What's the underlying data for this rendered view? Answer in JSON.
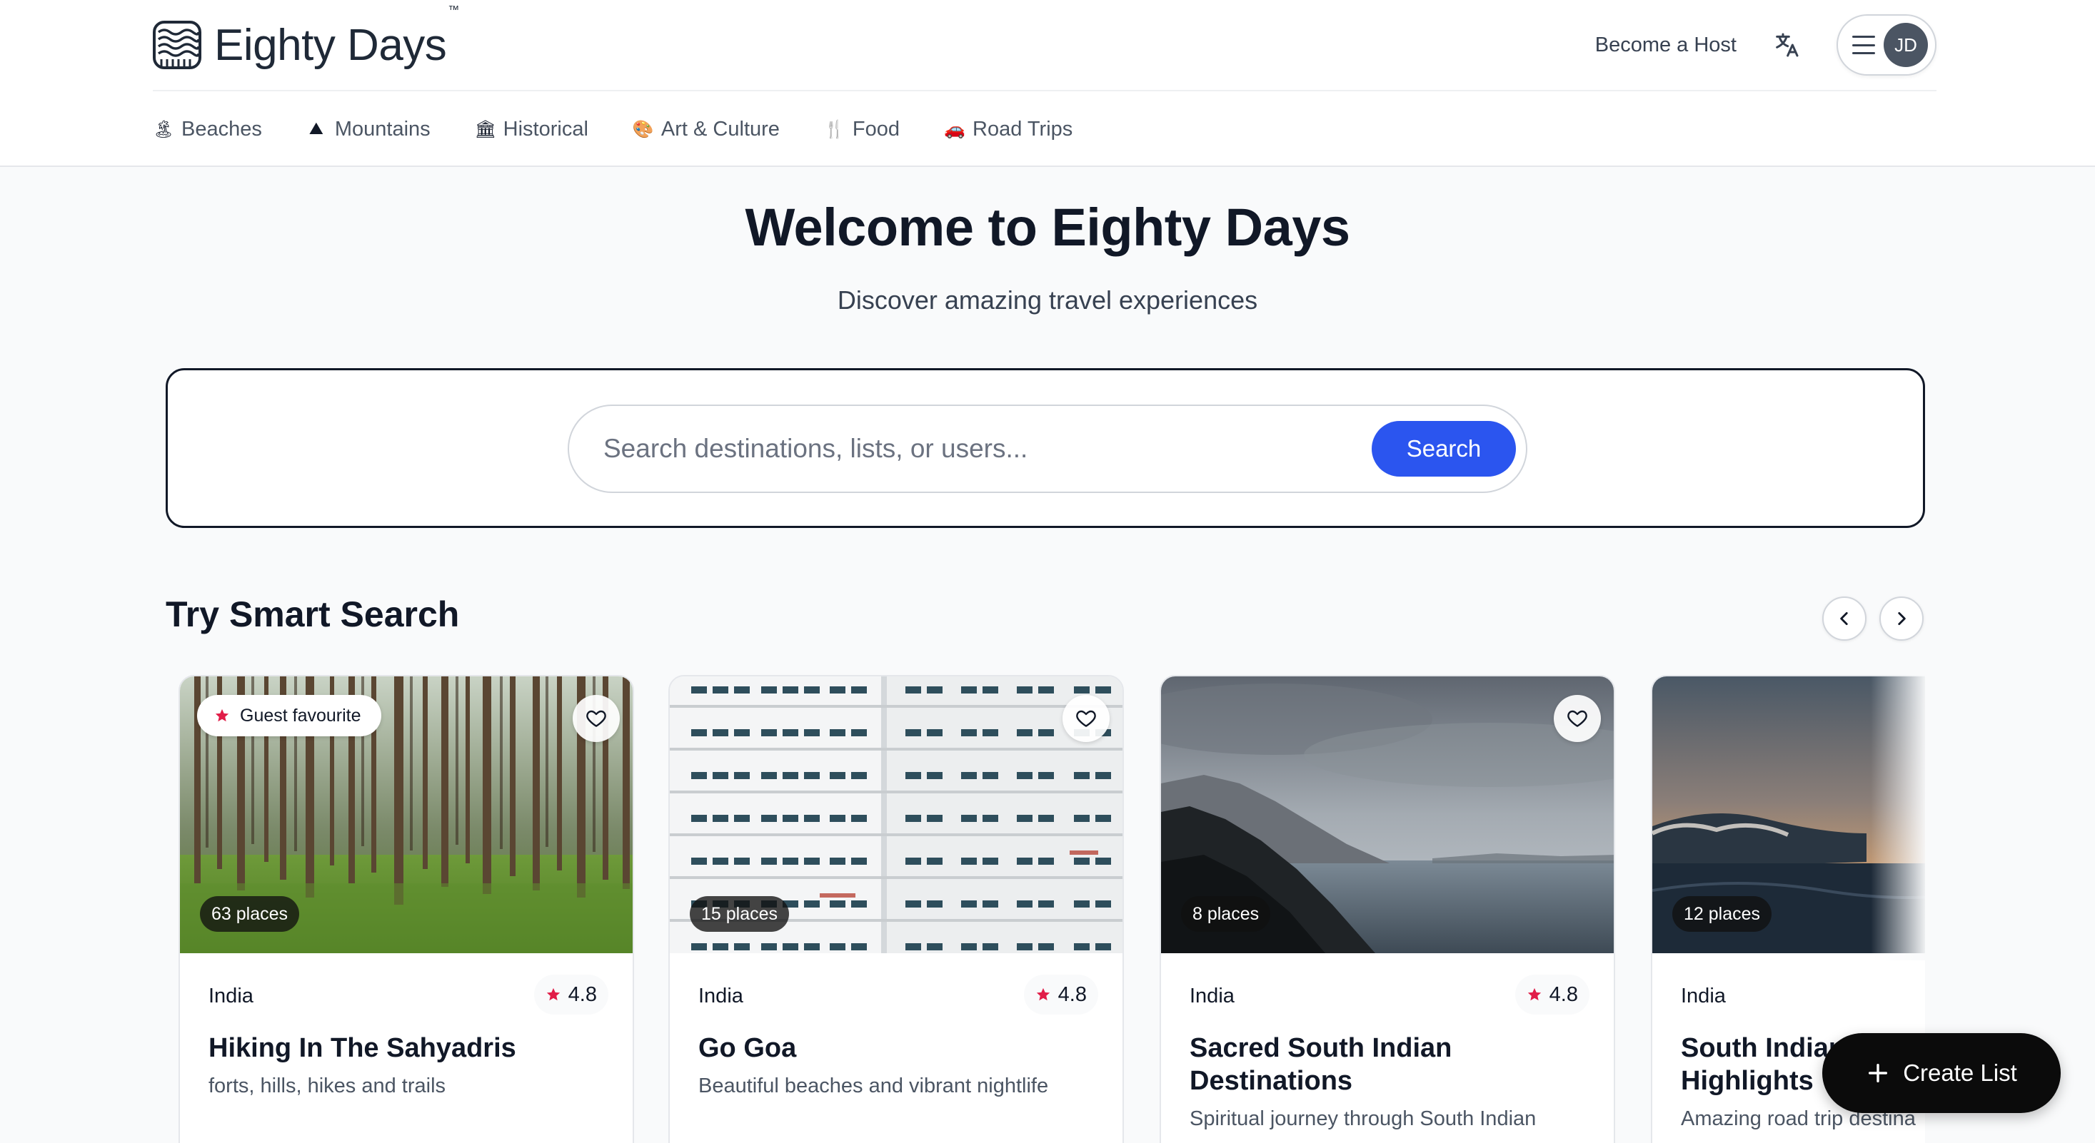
{
  "header": {
    "brand_name": "Eighty Days",
    "brand_tm": "™",
    "become_host": "Become a Host",
    "avatar_initials": "JD"
  },
  "categories": [
    {
      "icon": "🏝",
      "label": "Beaches"
    },
    {
      "icon": "⛰",
      "label": "Mountains"
    },
    {
      "icon": "🏛",
      "label": "Historical"
    },
    {
      "icon": "🎨",
      "label": "Art & Culture"
    },
    {
      "icon": "🍴",
      "label": "Food"
    },
    {
      "icon": "🚗",
      "label": "Road Trips"
    }
  ],
  "hero": {
    "title": "Welcome to Eighty Days",
    "subtitle": "Discover amazing travel experiences"
  },
  "search": {
    "placeholder": "Search destinations, lists, or users...",
    "button": "Search"
  },
  "section": {
    "title": "Try Smart Search"
  },
  "cards": [
    {
      "guest_favourite": "Guest favourite",
      "places": "63 places",
      "country": "India",
      "rating": "4.8",
      "title": "Hiking In The Sahyadris",
      "description": "forts, hills, hikes and trails"
    },
    {
      "places": "15 places",
      "country": "India",
      "rating": "4.8",
      "title": "Go Goa",
      "description": "Beautiful beaches and vibrant nightlife"
    },
    {
      "places": "8 places",
      "country": "India",
      "rating": "4.8",
      "title": "Sacred South Indian Destinations",
      "description": "Spiritual journey through South Indian"
    },
    {
      "places": "12 places",
      "country": "India",
      "title": "South Indian Highlights",
      "description": "Amazing road trip destina"
    }
  ],
  "fab": {
    "label": "Create List"
  },
  "colors": {
    "accent": "#2b55ef",
    "star": "#e11d48",
    "fab": "#0b0b0b"
  }
}
